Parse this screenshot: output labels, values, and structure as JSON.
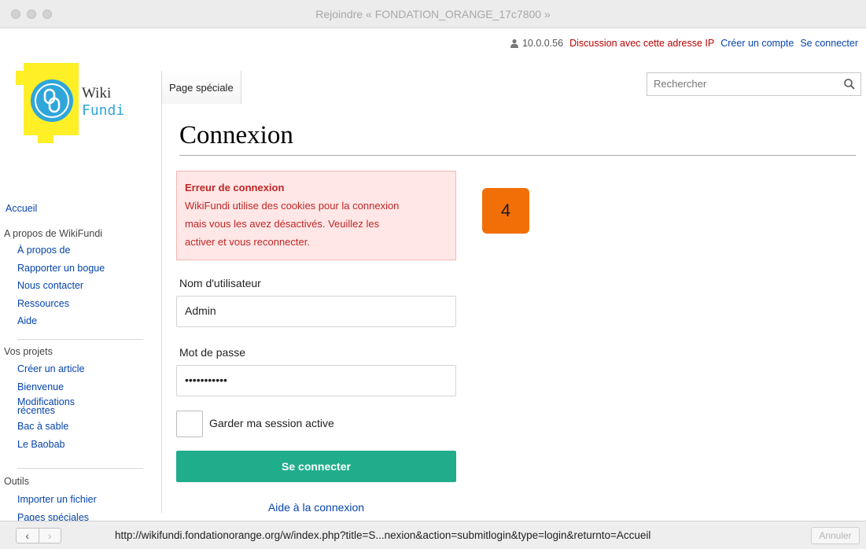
{
  "window": {
    "title": "Rejoindre « FONDATION_ORANGE_17c7800 »"
  },
  "personal": {
    "ip": "10.0.0.56",
    "discussion": "Discussion avec cette adresse IP",
    "create_account": "Créer un compte",
    "login": "Se connecter"
  },
  "logo": {
    "line1": "Wiki",
    "line2": "Fundi",
    "icon": "wikifundi-logo"
  },
  "tabs": {
    "special_page": "Page spéciale"
  },
  "search": {
    "placeholder": "Rechercher",
    "icon": "search-icon"
  },
  "page": {
    "title": "Connexion"
  },
  "error": {
    "title": "Erreur de connexion",
    "lines": [
      "WikiFundi utilise des cookies pour la connexion",
      "mais vous les avez désactivés. Veuillez les",
      "activer et vous reconnecter."
    ]
  },
  "annotation": {
    "step": "4"
  },
  "form": {
    "username_label": "Nom d'utilisateur",
    "username_value": "Admin",
    "password_label": "Mot de passe",
    "password_value": "•••••••••••",
    "remember_label": "Garder ma session active",
    "submit_label": "Se connecter",
    "help_link": "Aide à la connexion"
  },
  "sidebar": {
    "main": "Accueil",
    "portals": [
      {
        "heading": "A propos de WikiFundi",
        "items": [
          "À propos de",
          "Rapporter un bogue",
          "Nous contacter",
          "Ressources",
          "Aide"
        ]
      },
      {
        "heading": "Vos projets",
        "items": [
          "Créer un article",
          "Bienvenue",
          "Modifications récentes",
          "Bac à sable",
          "Le Baobab"
        ]
      },
      {
        "heading": "Outils",
        "items": [
          "Importer un fichier",
          "Pages spéciales"
        ]
      }
    ]
  },
  "statusbar": {
    "back": "‹",
    "forward": "›",
    "url": "http://wikifundi.fondationorange.org/w/index.php?title=S...nexion&action=submitlogin&type=login&returnto=Accueil",
    "cancel": "Annuler"
  },
  "colors": {
    "accent": "#1fad8b",
    "error_bg": "#fee7e6",
    "error_text": "#c02626",
    "link": "#0645ad",
    "badge": "#f26f07",
    "logo_yellow": "#ffef27",
    "logo_blue": "#2ea6db"
  }
}
